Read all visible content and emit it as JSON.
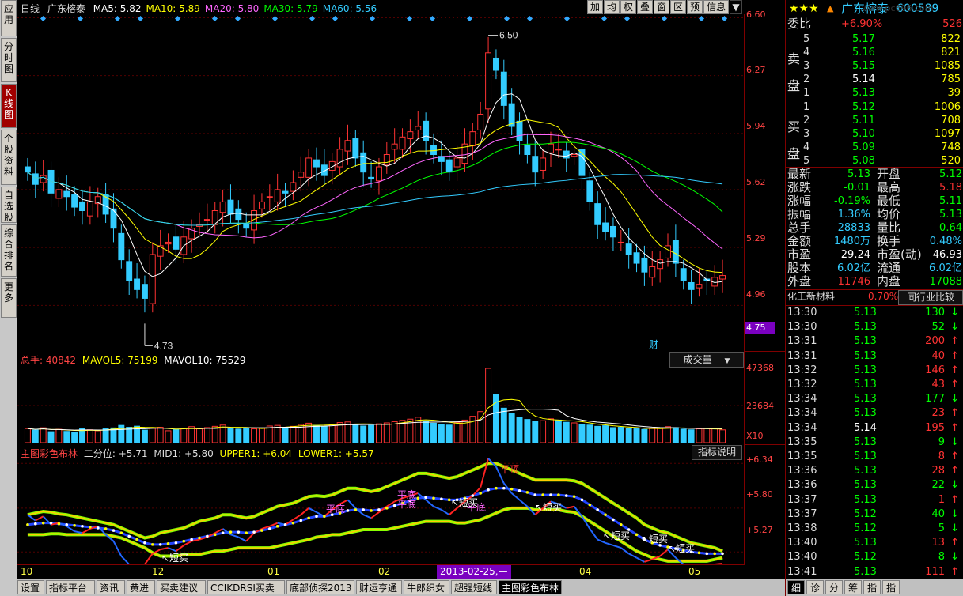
{
  "left_tabs": [
    "应用",
    "分时图",
    "K线图",
    "个股资料",
    "自选股",
    "综合排名",
    "更多"
  ],
  "main_chart": {
    "header_period": "日线",
    "stock_name": "广东榕泰",
    "ma": [
      {
        "label": "MA5: 5.82",
        "color": "#ffffff"
      },
      {
        "label": "MA10: 5.89",
        "color": "#ffff00"
      },
      {
        "label": "MA20: 5.80",
        "color": "#ff66ff"
      },
      {
        "label": "MA30: 5.79",
        "color": "#00ff00"
      },
      {
        "label": "MA60: 5.56",
        "color": "#33ccff"
      }
    ],
    "toolbar": [
      "加",
      "均",
      "权",
      "叠",
      "窗",
      "区",
      "预",
      "信息"
    ],
    "y_ticks": [
      "6.60",
      "6.27",
      "5.94",
      "5.62",
      "5.29",
      "4.96"
    ],
    "current_price_tag": "4.75",
    "high_label": "6.50",
    "low_label": "4.73",
    "cai_label": "财"
  },
  "volume_chart": {
    "label_total": "总手: 40842",
    "label_mavol5": "MAVOL5: 75199",
    "label_mavol10": "MAVOL10: 75529",
    "dropdown": "成交量",
    "y_ticks": [
      "47368",
      "23684"
    ],
    "unit": "X10"
  },
  "indicator_chart": {
    "title": "主图彩色布林",
    "erfenwei": "二分位: +5.71",
    "mid": "MID1: +5.80",
    "upper": "UPPER1: +6.04",
    "lower": "LOWER1: +5.57",
    "help_button": "指标说明",
    "y_ticks": [
      "+6.34",
      "+5.80",
      "+5.27"
    ],
    "annotations": [
      "平顶",
      "平底",
      "平底",
      "平底",
      "平底",
      "短买",
      "短买",
      "短买",
      "短买",
      "短买",
      "短买"
    ]
  },
  "x_axis": {
    "labels": [
      "10",
      "12",
      "01",
      "02",
      "03",
      "04",
      "05"
    ],
    "cursor_date": "2013-02-25,—"
  },
  "right_panel": {
    "header_name": "广东榕泰",
    "header_code": "600589",
    "watermark": "www.pc696.com",
    "weibi_label": "委比",
    "weibi_value": "+6.90%",
    "weibi_diff": "526",
    "sell_label": "卖盘",
    "buy_label": "买盘",
    "sell": [
      {
        "level": "5",
        "price": "5.17",
        "vol": "822"
      },
      {
        "level": "4",
        "price": "5.16",
        "vol": "821"
      },
      {
        "level": "3",
        "price": "5.15",
        "vol": "1085"
      },
      {
        "level": "2",
        "price": "5.14",
        "vol": "785"
      },
      {
        "level": "1",
        "price": "5.13",
        "vol": "39"
      }
    ],
    "buy": [
      {
        "level": "1",
        "price": "5.12",
        "vol": "1006"
      },
      {
        "level": "2",
        "price": "5.11",
        "vol": "708"
      },
      {
        "level": "3",
        "price": "5.10",
        "vol": "1097"
      },
      {
        "level": "4",
        "price": "5.09",
        "vol": "748"
      },
      {
        "level": "5",
        "price": "5.08",
        "vol": "520"
      }
    ],
    "stats": [
      {
        "l1": "最新",
        "v1": "5.13",
        "l2": "开盘",
        "v2": "5.12",
        "c1": "#00ff00",
        "c2": "#00ff00"
      },
      {
        "l1": "涨跌",
        "v1": "-0.01",
        "l2": "最高",
        "v2": "5.18",
        "c1": "#00ff00",
        "c2": "#ff3333"
      },
      {
        "l1": "涨幅",
        "v1": "-0.19%",
        "l2": "最低",
        "v2": "5.11",
        "c1": "#00ff00",
        "c2": "#00ff00"
      },
      {
        "l1": "振幅",
        "v1": "1.36%",
        "l2": "均价",
        "v2": "5.13",
        "c1": "#33ccff",
        "c2": "#00ff00"
      },
      {
        "l1": "总手",
        "v1": "28833",
        "l2": "量比",
        "v2": "0.64",
        "c1": "#33ccff",
        "c2": "#00ff00"
      },
      {
        "l1": "金额",
        "v1": "1480万",
        "l2": "换手",
        "v2": "0.48%",
        "c1": "#33ccff",
        "c2": "#33ccff"
      },
      {
        "l1": "市盈",
        "v1": "29.24",
        "l2": "市盈(动)",
        "v2": "46.93",
        "c1": "#ffffff",
        "c2": "#ffffff"
      },
      {
        "l1": "股本",
        "v1": "6.02亿",
        "l2": "流通",
        "v2": "6.02亿",
        "c1": "#33ccff",
        "c2": "#33ccff"
      },
      {
        "l1": "外盘",
        "v1": "11746",
        "l2": "内盘",
        "v2": "17088",
        "c1": "#ff3333",
        "c2": "#00ff00"
      }
    ],
    "industry_name": "化工新材料",
    "industry_change": "0.70%",
    "industry_button": "同行业比较",
    "ticks": [
      {
        "time": "13:30",
        "price": "5.13",
        "vol": "130",
        "dir": "down",
        "pc": "#00ff00",
        "vc": "#00ff00"
      },
      {
        "time": "13:30",
        "price": "5.13",
        "vol": "52",
        "dir": "down",
        "pc": "#00ff00",
        "vc": "#00ff00"
      },
      {
        "time": "13:31",
        "price": "5.13",
        "vol": "200",
        "dir": "up",
        "pc": "#00ff00",
        "vc": "#ff3333"
      },
      {
        "time": "13:31",
        "price": "5.13",
        "vol": "40",
        "dir": "up",
        "pc": "#00ff00",
        "vc": "#ff3333"
      },
      {
        "time": "13:32",
        "price": "5.13",
        "vol": "146",
        "dir": "up",
        "pc": "#00ff00",
        "vc": "#ff3333"
      },
      {
        "time": "13:32",
        "price": "5.13",
        "vol": "43",
        "dir": "up",
        "pc": "#00ff00",
        "vc": "#ff3333"
      },
      {
        "time": "13:34",
        "price": "5.13",
        "vol": "177",
        "dir": "down",
        "pc": "#00ff00",
        "vc": "#00ff00"
      },
      {
        "time": "13:34",
        "price": "5.13",
        "vol": "23",
        "dir": "up",
        "pc": "#00ff00",
        "vc": "#ff3333"
      },
      {
        "time": "13:34",
        "price": "5.14",
        "vol": "195",
        "dir": "up",
        "pc": "#ffffff",
        "vc": "#ff3333"
      },
      {
        "time": "13:35",
        "price": "5.13",
        "vol": "9",
        "dir": "down",
        "pc": "#00ff00",
        "vc": "#00ff00"
      },
      {
        "time": "13:35",
        "price": "5.13",
        "vol": "8",
        "dir": "up",
        "pc": "#00ff00",
        "vc": "#ff3333"
      },
      {
        "time": "13:36",
        "price": "5.13",
        "vol": "28",
        "dir": "up",
        "pc": "#00ff00",
        "vc": "#ff3333"
      },
      {
        "time": "13:36",
        "price": "5.13",
        "vol": "22",
        "dir": "down",
        "pc": "#00ff00",
        "vc": "#00ff00"
      },
      {
        "time": "13:37",
        "price": "5.13",
        "vol": "1",
        "dir": "up",
        "pc": "#00ff00",
        "vc": "#ff3333"
      },
      {
        "time": "13:37",
        "price": "5.12",
        "vol": "40",
        "dir": "down",
        "pc": "#00ff00",
        "vc": "#00ff00"
      },
      {
        "time": "13:38",
        "price": "5.12",
        "vol": "5",
        "dir": "down",
        "pc": "#00ff00",
        "vc": "#00ff00"
      },
      {
        "time": "13:40",
        "price": "5.13",
        "vol": "13",
        "dir": "up",
        "pc": "#00ff00",
        "vc": "#ff3333"
      },
      {
        "time": "13:40",
        "price": "5.12",
        "vol": "8",
        "dir": "down",
        "pc": "#00ff00",
        "vc": "#00ff00"
      },
      {
        "time": "13:41",
        "price": "5.13",
        "vol": "111",
        "dir": "up",
        "pc": "#00ff00",
        "vc": "#ff3333"
      }
    ],
    "bottom_tabs": [
      "细",
      "诊",
      "分",
      "筹",
      "指",
      "指"
    ]
  },
  "bottom_tabs": [
    "设置",
    "指标平台",
    "资讯",
    "黄进",
    "买卖建议",
    "CCIKDRSI买卖",
    "底部侦探2013",
    "财运亨通",
    "牛郎织女",
    "超强短线",
    "主图彩色布林"
  ],
  "chart_data": [
    {
      "type": "candlestick",
      "title": "日线",
      "ylim": [
        4.7,
        6.62
      ],
      "y_ticks": [
        6.6,
        6.27,
        5.94,
        5.62,
        5.29,
        4.96
      ],
      "x_labels": [
        "10",
        "12",
        "01",
        "02",
        "03",
        "04",
        "05"
      ],
      "high": 6.5,
      "low": 4.73,
      "ma_last": {
        "MA5": 5.82,
        "MA10": 5.89,
        "MA20": 5.8,
        "MA30": 5.79,
        "MA60": 5.56
      },
      "close_series": [
        5.72,
        5.65,
        5.7,
        5.6,
        5.62,
        5.58,
        5.52,
        5.5,
        5.55,
        5.58,
        5.48,
        5.4,
        5.22,
        5.1,
        5.05,
        5.0,
        5.25,
        5.3,
        5.32,
        5.28,
        5.35,
        5.4,
        5.42,
        5.45,
        5.5,
        5.55,
        5.48,
        5.45,
        5.4,
        5.5,
        5.55,
        5.58,
        5.62,
        5.6,
        5.66,
        5.72,
        5.8,
        5.75,
        5.7,
        5.78,
        5.85,
        5.9,
        5.8,
        5.72,
        5.68,
        5.75,
        5.82,
        5.88,
        5.92,
        5.95,
        5.98,
        5.9,
        5.82,
        5.78,
        5.72,
        5.8,
        5.88,
        5.95,
        6.05,
        6.4,
        6.3,
        6.1,
        5.98,
        5.9,
        5.82,
        5.72,
        5.8,
        5.88,
        5.85,
        5.8,
        5.82,
        5.7,
        5.55,
        5.42,
        5.38,
        5.35,
        5.32,
        5.25,
        5.2,
        5.15,
        5.18,
        5.22,
        5.3,
        5.2,
        5.1,
        5.05,
        5.08,
        5.1,
        5.12,
        5.13
      ]
    },
    {
      "type": "bar",
      "title": "成交量",
      "ylim": [
        0,
        47368
      ],
      "y_ticks": [
        47368,
        23684
      ],
      "values": [
        9000,
        8000,
        9500,
        7000,
        8500,
        7200,
        6800,
        9000,
        8200,
        7600,
        8800,
        9400,
        11000,
        9800,
        10500,
        8000,
        9200,
        9800,
        7600,
        8400,
        9000,
        10200,
        8800,
        9600,
        10400,
        11200,
        9000,
        8600,
        9400,
        8800,
        9200,
        10600,
        11000,
        9800,
        10400,
        11600,
        12400,
        11000,
        10200,
        11400,
        12800,
        13200,
        11800,
        10600,
        11000,
        12000,
        12600,
        13400,
        14200,
        15000,
        16200,
        13800,
        12400,
        11600,
        11200,
        12800,
        14400,
        16800,
        19800,
        47368,
        30500,
        22000,
        18400,
        16200,
        14800,
        13600,
        14000,
        15200,
        14400,
        13000,
        12600,
        11800,
        11200,
        10400,
        10800,
        9600,
        9800,
        9200,
        8800,
        8400,
        9000,
        9400,
        10200,
        9600,
        8600,
        8200,
        8800,
        9200,
        9000,
        8167
      ]
    },
    {
      "type": "line",
      "title": "主图彩色布林",
      "ylim": [
        5.12,
        6.4
      ],
      "y_ticks": [
        6.34,
        5.8,
        5.27
      ],
      "series": [
        {
          "name": "UPPER1",
          "values": [
            5.72,
            5.74,
            5.76,
            5.75,
            5.73,
            5.72,
            5.7,
            5.68,
            5.66,
            5.64,
            5.62,
            5.6,
            5.56,
            5.52,
            5.48,
            5.44,
            5.46,
            5.5,
            5.52,
            5.54,
            5.56,
            5.6,
            5.64,
            5.66,
            5.68,
            5.72,
            5.72,
            5.7,
            5.68,
            5.7,
            5.74,
            5.78,
            5.82,
            5.84,
            5.86,
            5.9,
            5.94,
            5.95,
            5.94,
            5.96,
            6.0,
            6.04,
            6.04,
            6.02,
            6.0,
            6.02,
            6.06,
            6.1,
            6.14,
            6.18,
            6.22,
            6.22,
            6.2,
            6.18,
            6.16,
            6.18,
            6.22,
            6.26,
            6.3,
            6.34,
            6.34,
            6.3,
            6.26,
            6.22,
            6.18,
            6.14,
            6.14,
            6.14,
            6.14,
            6.14,
            6.13,
            6.1,
            6.04,
            5.98,
            5.92,
            5.86,
            5.8,
            5.74,
            5.68,
            5.6,
            5.56,
            5.52,
            5.5,
            5.46,
            5.42,
            5.38,
            5.36,
            5.34,
            5.32,
            5.28
          ]
        },
        {
          "name": "MID1",
          "values": [
            5.6,
            5.61,
            5.62,
            5.62,
            5.61,
            5.6,
            5.59,
            5.58,
            5.57,
            5.56,
            5.55,
            5.53,
            5.5,
            5.46,
            5.42,
            5.38,
            5.36,
            5.36,
            5.37,
            5.38,
            5.4,
            5.42,
            5.44,
            5.46,
            5.48,
            5.5,
            5.51,
            5.51,
            5.5,
            5.51,
            5.53,
            5.55,
            5.58,
            5.6,
            5.62,
            5.65,
            5.68,
            5.7,
            5.7,
            5.72,
            5.74,
            5.77,
            5.78,
            5.78,
            5.77,
            5.78,
            5.8,
            5.83,
            5.86,
            5.89,
            5.92,
            5.93,
            5.92,
            5.91,
            5.9,
            5.9,
            5.92,
            5.95,
            5.98,
            6.02,
            6.04,
            6.04,
            6.03,
            6.01,
            5.99,
            5.96,
            5.96,
            5.96,
            5.96,
            5.95,
            5.94,
            5.9,
            5.84,
            5.78,
            5.72,
            5.66,
            5.6,
            5.54,
            5.48,
            5.42,
            5.38,
            5.35,
            5.33,
            5.31,
            5.29,
            5.27,
            5.26,
            5.25,
            5.25,
            5.25
          ]
        },
        {
          "name": "LOWER1",
          "values": [
            5.48,
            5.48,
            5.48,
            5.49,
            5.49,
            5.48,
            5.48,
            5.48,
            5.48,
            5.48,
            5.48,
            5.46,
            5.44,
            5.4,
            5.36,
            5.32,
            5.26,
            5.22,
            5.22,
            5.22,
            5.24,
            5.24,
            5.24,
            5.26,
            5.28,
            5.28,
            5.3,
            5.32,
            5.32,
            5.32,
            5.32,
            5.32,
            5.34,
            5.36,
            5.38,
            5.4,
            5.42,
            5.45,
            5.46,
            5.48,
            5.48,
            5.5,
            5.52,
            5.54,
            5.54,
            5.54,
            5.54,
            5.56,
            5.58,
            5.6,
            5.62,
            5.64,
            5.64,
            5.64,
            5.64,
            5.62,
            5.62,
            5.64,
            5.66,
            5.7,
            5.74,
            5.78,
            5.8,
            5.8,
            5.8,
            5.78,
            5.78,
            5.78,
            5.78,
            5.76,
            5.75,
            5.7,
            5.64,
            5.58,
            5.52,
            5.46,
            5.4,
            5.34,
            5.28,
            5.24,
            5.2,
            5.18,
            5.16,
            5.16,
            5.16,
            5.16,
            5.16,
            5.16,
            5.18,
            5.2
          ]
        }
      ]
    }
  ]
}
